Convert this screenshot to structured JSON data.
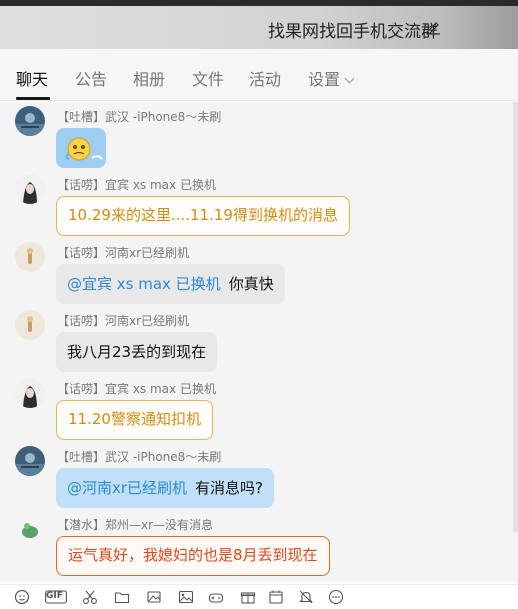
{
  "window": {
    "title": "找果网找回手机交流群"
  },
  "tabs": [
    {
      "label": "聊天",
      "active": true
    },
    {
      "label": "公告"
    },
    {
      "label": "相册"
    },
    {
      "label": "文件"
    },
    {
      "label": "活动"
    },
    {
      "label": "设置"
    }
  ],
  "messages": [
    {
      "sender": "【吐槽】武汉 -iPhone8～未刷",
      "type": "sticker",
      "bubble": "blue"
    },
    {
      "sender": "【话唠】宜宾 xs max 已换机",
      "text": "10.29来的这里....11.19得到换机的消息",
      "bubble": "orange"
    },
    {
      "sender": "【话唠】河南xr已经刷机",
      "mention": "@宜宾 xs max 已换机",
      "text": "你真快",
      "bubble": "gray"
    },
    {
      "sender": "【话唠】河南xr已经刷机",
      "text": "我八月23丢的到现在",
      "bubble": "gray"
    },
    {
      "sender": "【话唠】宜宾 xs max 已换机",
      "text": "11.20警察通知扣机",
      "bubble": "orange"
    },
    {
      "sender": "【吐槽】武汉 -iPhone8～未刷",
      "mention": "@河南xr已经刷机",
      "text": "有消息吗?",
      "bubble": "blue"
    },
    {
      "sender": "【潜水】郑州—xr—没有消息",
      "text": "运气真好，我媳妇的也是8月丢到现在",
      "bubble": "red"
    }
  ],
  "toolbar": {
    "gif_label": "GIF",
    "icons": [
      "emoji-icon",
      "gif-icon",
      "scissors-icon",
      "folder-icon",
      "image-library-icon",
      "image-icon",
      "gamepad-icon",
      "gift-icon",
      "calendar-icon",
      "bell-off-icon",
      "more-icon"
    ]
  },
  "colors": {
    "accent_blue": "#2a8bd8",
    "orange": "#d88a16",
    "red": "#e2481f",
    "bubble_blue": "#bfe0f7",
    "bubble_gray": "#e8e8e8"
  }
}
